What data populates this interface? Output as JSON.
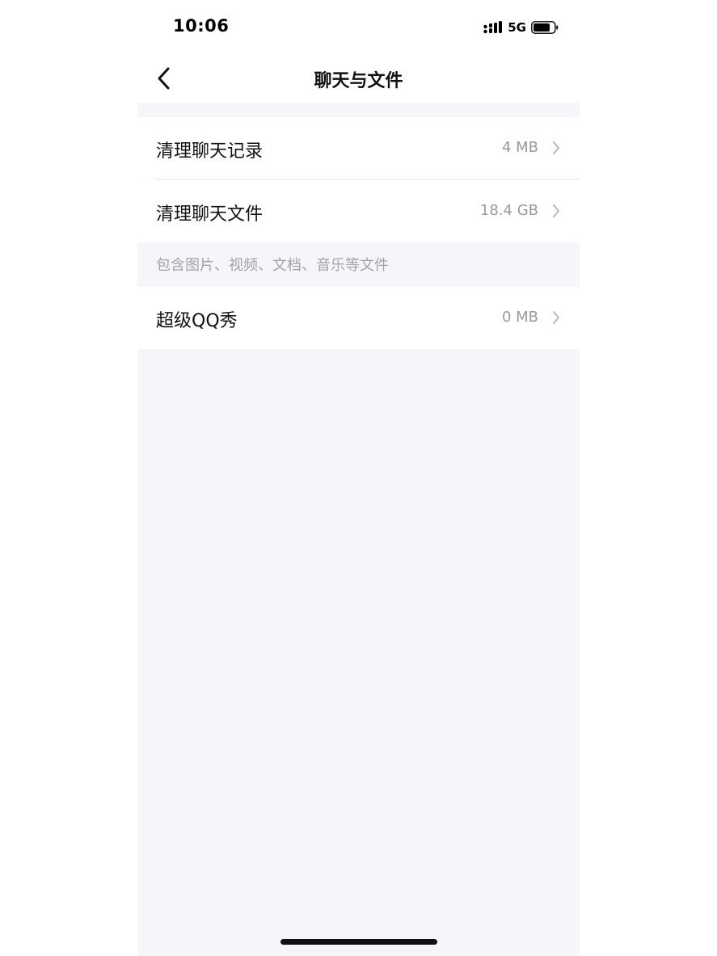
{
  "status_bar": {
    "time": "10:06",
    "network": "5G",
    "signal_icon": "signal-bars-icon",
    "battery_icon": "battery-icon"
  },
  "nav": {
    "title": "聊天与文件",
    "back_icon": "chevron-left-icon"
  },
  "rows": [
    {
      "label": "清理聊天记录",
      "value": "4 MB"
    },
    {
      "label": "清理聊天文件",
      "value": "18.4 GB"
    },
    {
      "label": "超级QQ秀",
      "value": "0 MB"
    }
  ],
  "note": "包含图片、视频、文档、音乐等文件",
  "colors": {
    "background": "#f5f6fa",
    "card": "#ffffff",
    "text": "#111111",
    "secondary_text": "#999999"
  }
}
